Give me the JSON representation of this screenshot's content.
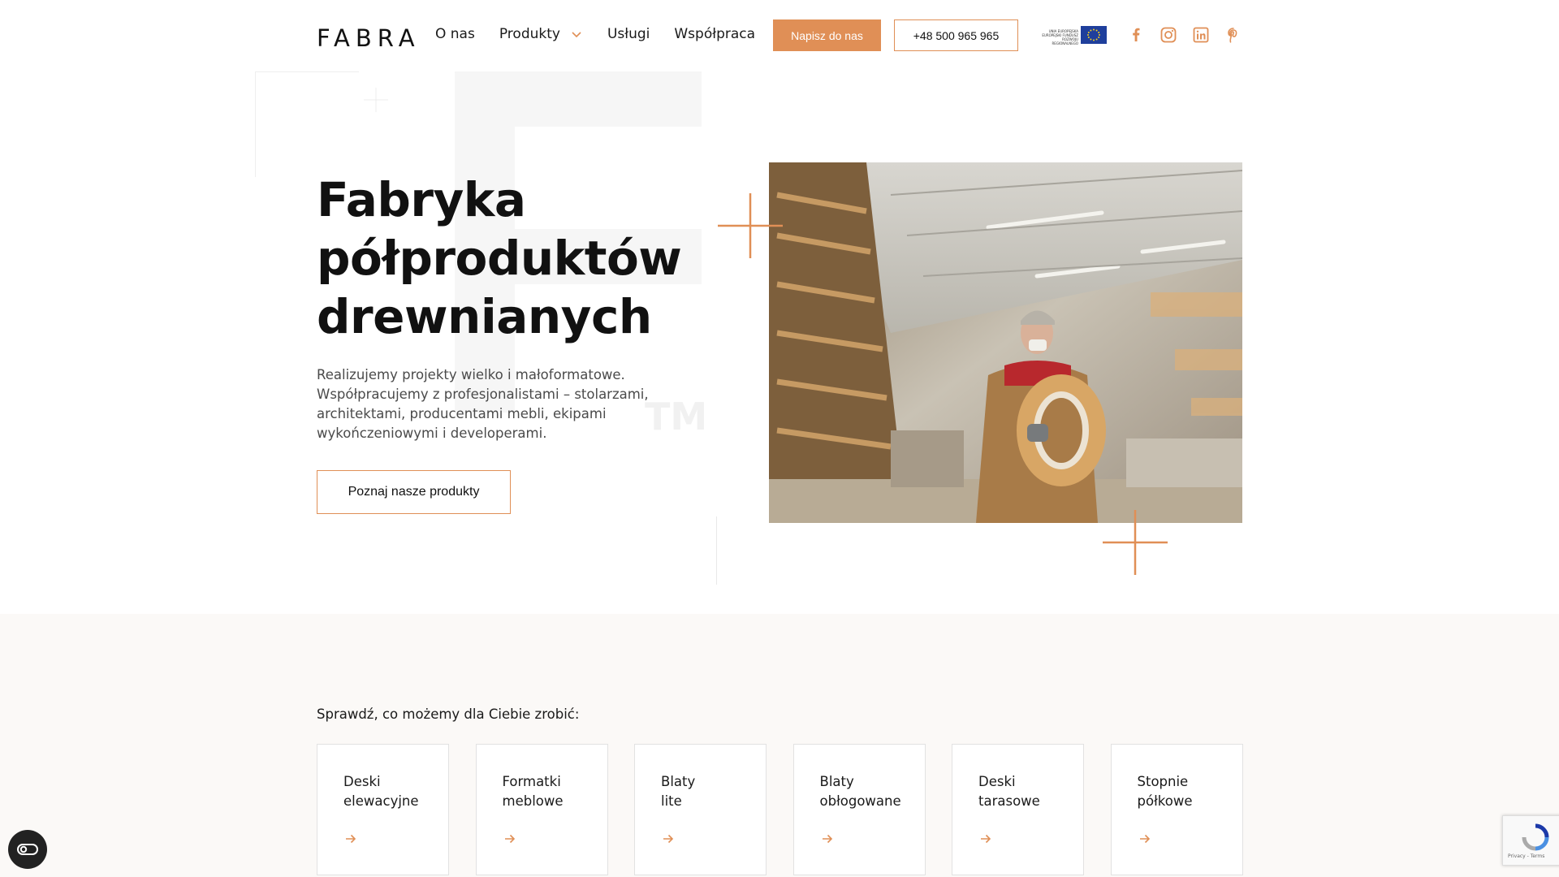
{
  "header": {
    "logo": "FABRA",
    "nav": [
      {
        "label": "O nas",
        "dropdown": false
      },
      {
        "label": "Produkty",
        "dropdown": true
      },
      {
        "label": "Usługi",
        "dropdown": false
      },
      {
        "label": "Współpraca",
        "dropdown": false
      }
    ],
    "contact_button": "Napisz do nas",
    "phone_button": "+48 500 965 965",
    "eu_badge_text": "UNIA EUROPEJSKA EUROPEJSKI FUNDUSZ ROZWOJU REGIONALNEGO",
    "socials": [
      "facebook-icon",
      "instagram-icon",
      "linkedin-icon",
      "pinterest-icon"
    ]
  },
  "hero": {
    "title_lines": [
      "Fabryka",
      "półproduktów",
      "drewnianych"
    ],
    "description": "Realizujemy projekty wielko i małoformatowe. Współpracujemy z profesjonalistami – stolarzami, architektami, producentami mebli, ekipami wykończeniowymi i developerami.",
    "cta": "Poznaj nasze produkty",
    "deco_tm": "TM"
  },
  "services": {
    "heading": "Sprawdź, co możemy dla Ciebie zrobić:",
    "cards": [
      {
        "line1": "Deski",
        "line2": "elewacyjne"
      },
      {
        "line1": "Formatki",
        "line2": "meblowe"
      },
      {
        "line1": "Blaty",
        "line2": "lite"
      },
      {
        "line1": "Blaty",
        "line2": "obłogowane"
      },
      {
        "line1": "Deski",
        "line2": "tarasowe"
      },
      {
        "line1": "Stopnie",
        "line2": "półkowe"
      }
    ]
  },
  "widgets": {
    "recaptcha_text": "Privacy - Terms"
  },
  "colors": {
    "accent": "#e08f56",
    "text": "#111111",
    "muted": "#4a4a4a",
    "section_bg": "#fbf9f7"
  }
}
